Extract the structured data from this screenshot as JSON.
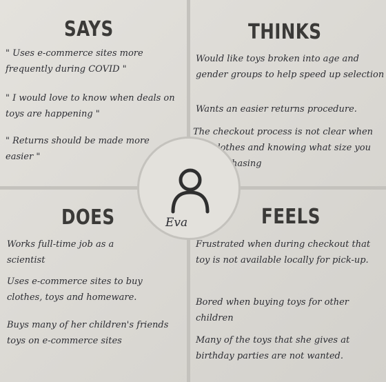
{
  "says": {
    "heading": "SAYS",
    "notes": [
      "\" Uses e-commerce sites more frequently during COVID \"",
      "\" I would love to know when deals on toys are happening \"",
      "\" Returns should be made more easier \""
    ]
  },
  "thinks": {
    "heading": "THINKS",
    "notes": [
      "Would like toys broken into age and gender groups to help speed up selection",
      "Wants an easier returns procedure.",
      "The checkout process is not clear when buy clothes and knowing what size you are purchasing"
    ]
  },
  "does": {
    "heading": "DOES",
    "notes": [
      "Works full-time job as a scientist",
      "Uses e-commerce sites to buy clothes, toys and homeware.",
      "Buys many of her children's friends toys on e-commerce sites"
    ]
  },
  "feels": {
    "heading": "FEELS",
    "notes": [
      "Frustrated when during checkout that toy is not available locally for pick-up.",
      "Bored when buying toys for other children",
      "Many of the toys that she gives at birthday parties are not wanted."
    ]
  },
  "persona": {
    "name": "Eva",
    "icon": "person-icon"
  }
}
